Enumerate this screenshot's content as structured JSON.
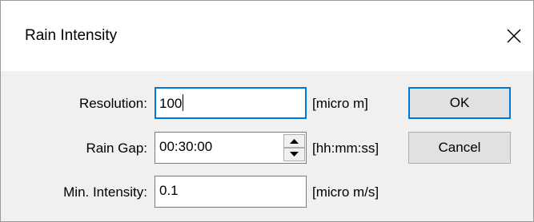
{
  "window": {
    "title": "Rain Intensity",
    "close_icon": "close-icon"
  },
  "form": {
    "resolution": {
      "label": "Resolution:",
      "value": "100",
      "unit": "[micro m]"
    },
    "rain_gap": {
      "label": "Rain Gap:",
      "value": "00:30:00",
      "unit": "[hh:mm:ss]"
    },
    "min_intensity": {
      "label": "Min. Intensity:",
      "value": "0.1",
      "unit": "[micro m/s]"
    }
  },
  "buttons": {
    "ok": "OK",
    "cancel": "Cancel"
  },
  "colors": {
    "focus": "#0078d7",
    "dialog_bg": "#f0f0f0",
    "button_bg": "#e1e1e1"
  }
}
